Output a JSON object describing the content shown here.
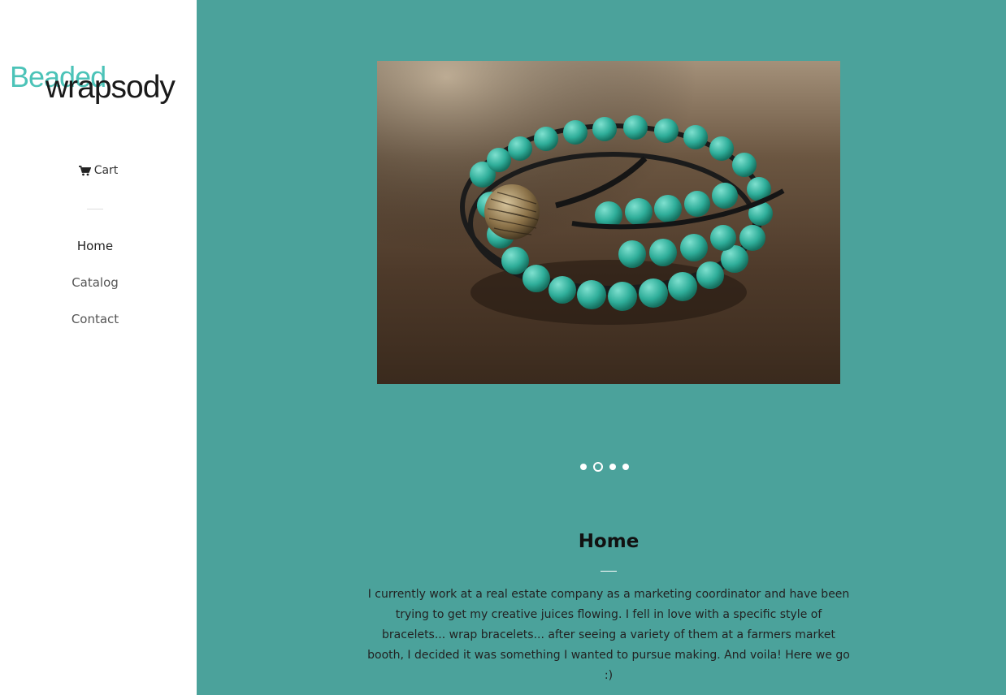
{
  "brand": {
    "word1": "Beaded",
    "word2": "wrapsody"
  },
  "sidebar": {
    "cart_label": "Cart",
    "nav": [
      {
        "label": "Home",
        "active": true
      },
      {
        "label": "Catalog",
        "active": false
      },
      {
        "label": "Contact",
        "active": false
      }
    ]
  },
  "slideshow": {
    "image_alt": "Turquoise beaded leather wrap bracelet with a bronze button clasp",
    "slide_count": 4,
    "active_slide": 2
  },
  "content": {
    "title": "Home",
    "body": "I currently work at a real estate company as a marketing coordinator and have been trying to get my creative juices flowing. I fell in love with a specific style of bracelets... wrap bracelets... after seeing a variety of them at a farmers market booth, I decided it was something I wanted to pursue making. And voila! Here we go :)"
  },
  "colors": {
    "background": "#4ba29b",
    "sidebar": "#ffffff",
    "logo_accent": "#4cc3b8",
    "bead": "#2fae9a"
  },
  "icons": {
    "cart": "cart-icon"
  }
}
